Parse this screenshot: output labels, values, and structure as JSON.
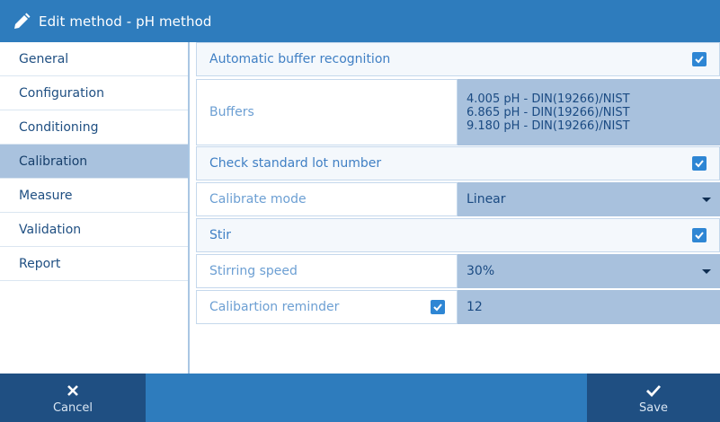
{
  "header": {
    "title": "Edit method - pH method",
    "icon": "pencil-icon"
  },
  "sidebar": {
    "items": [
      {
        "label": "General"
      },
      {
        "label": "Configuration"
      },
      {
        "label": "Conditioning"
      },
      {
        "label": "Calibration",
        "active": true
      },
      {
        "label": "Measure"
      },
      {
        "label": "Validation"
      },
      {
        "label": "Report"
      }
    ]
  },
  "settings": {
    "auto_buffer": {
      "label": "Automatic buffer recognition",
      "checked": true
    },
    "buffers": {
      "label": "Buffers",
      "values": [
        "4.005 pH - DIN(19266)/NIST",
        "6.865 pH - DIN(19266)/NIST",
        "9.180 pH - DIN(19266)/NIST"
      ]
    },
    "check_lot": {
      "label": "Check standard lot number",
      "checked": true
    },
    "calibrate_mode": {
      "label": "Calibrate mode",
      "value": "Linear"
    },
    "stir": {
      "label": "Stir",
      "checked": true
    },
    "stirring_speed": {
      "label": "Stirring speed",
      "value": "30%"
    },
    "reminder": {
      "label": "Calibartion reminder",
      "checked": true,
      "value": "12"
    }
  },
  "footer": {
    "cancel_label": "Cancel",
    "save_label": "Save"
  },
  "colors": {
    "accent": "#2e7cbd",
    "dark_button": "#1f4f82",
    "selected": "#a9c2de",
    "checkbox": "#2e86d4"
  }
}
